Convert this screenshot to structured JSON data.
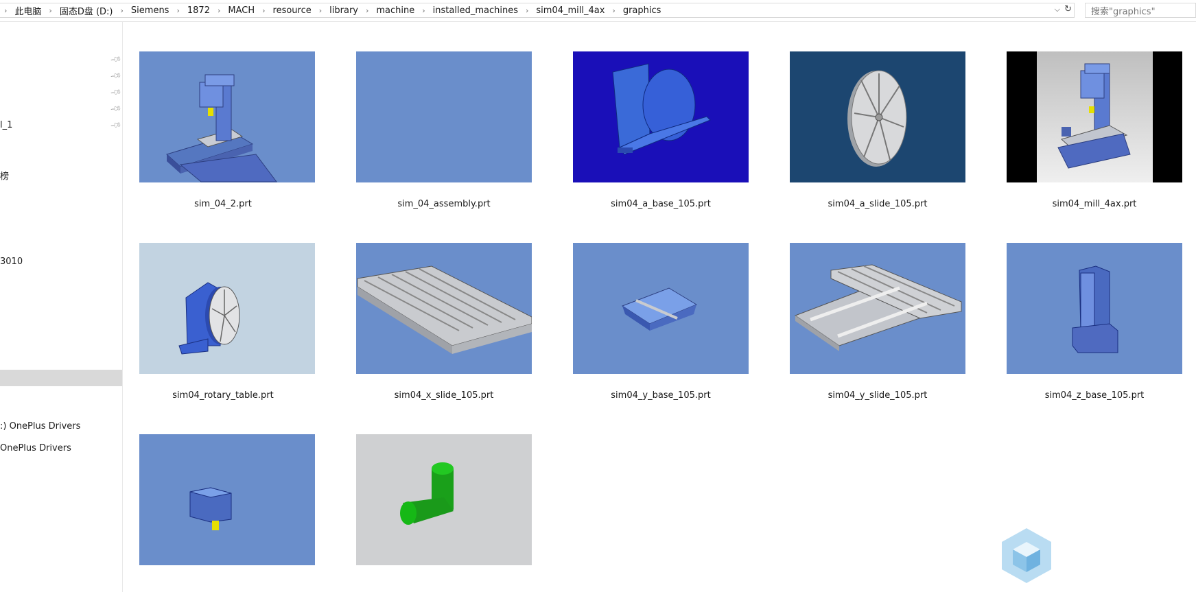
{
  "breadcrumb": {
    "items": [
      "此电脑",
      "固态D盘 (D:)",
      "Siemens",
      "1872",
      "MACH",
      "resource",
      "library",
      "machine",
      "installed_machines",
      "sim04_mill_4ax",
      "graphics"
    ]
  },
  "search": {
    "placeholder": "搜索\"graphics\""
  },
  "sidebar": {
    "partial_labels": [
      "l_1",
      "榜",
      "3010",
      ":) OnePlus Drivers",
      " OnePlus Drivers"
    ]
  },
  "files": [
    {
      "name": "sim_04_2.prt",
      "icon": "mill-machine-thumb"
    },
    {
      "name": "sim_04_assembly.prt",
      "icon": "blank-thumb"
    },
    {
      "name": "sim04_a_base_105.prt",
      "icon": "a-base-thumb"
    },
    {
      "name": "sim04_a_slide_105.prt",
      "icon": "a-slide-disc-thumb"
    },
    {
      "name": "sim04_mill_4ax.prt",
      "icon": "mill-4ax-thumb"
    },
    {
      "name": "sim04_rotary_table.prt",
      "icon": "rotary-table-thumb"
    },
    {
      "name": "sim04_x_slide_105.prt",
      "icon": "x-slide-thumb"
    },
    {
      "name": "sim04_y_base_105.prt",
      "icon": "y-base-thumb"
    },
    {
      "name": "sim04_y_slide_105.prt",
      "icon": "y-slide-thumb"
    },
    {
      "name": "sim04_z_base_105.prt",
      "icon": "z-base-thumb"
    },
    {
      "name": "",
      "icon": "spindle-thumb"
    },
    {
      "name": "",
      "icon": "green-elbow-thumb"
    }
  ],
  "colors": {
    "thumb_blue": "#6a8ecb",
    "thumb_dark_blue": "#1a0fb8",
    "thumb_navy": "#1c4670",
    "thumb_light": "#c2d3e1",
    "thumb_grey": "#cfd0d2",
    "selection": "#d9d9d9"
  }
}
